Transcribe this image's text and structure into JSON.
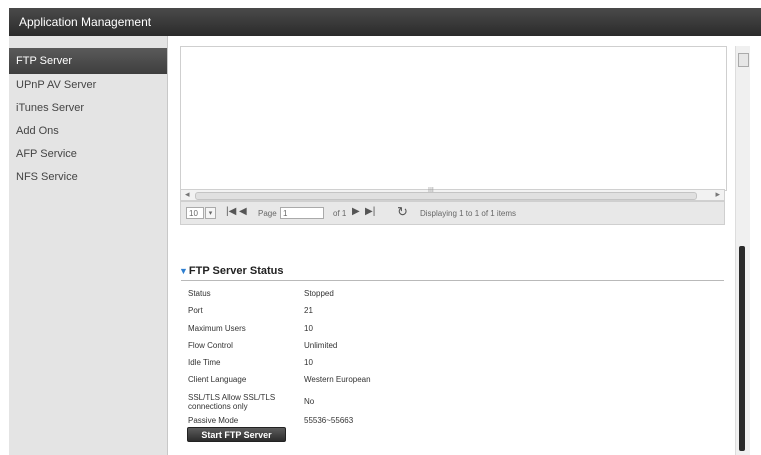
{
  "window": {
    "title": "Application Management"
  },
  "sidebar": {
    "items": [
      {
        "label": "FTP Server"
      },
      {
        "label": "UPnP AV Server"
      },
      {
        "label": "iTunes Server"
      },
      {
        "label": "Add Ons"
      },
      {
        "label": "AFP Service"
      },
      {
        "label": "NFS Service"
      }
    ]
  },
  "grid": {
    "hscroll_grip": "III",
    "pager": {
      "page_size": "10",
      "page_label": "Page",
      "page_value": "1",
      "of_label": "of 1",
      "displaying": "Displaying 1 to 1 of 1 items"
    }
  },
  "status": {
    "title": "FTP Server Status",
    "rows": [
      {
        "label": "Status",
        "value": "Stopped"
      },
      {
        "label": "Port",
        "value": "21"
      },
      {
        "label": "Maximum Users",
        "value": "10"
      },
      {
        "label": "Flow Control",
        "value": "Unlimited"
      },
      {
        "label": "Idle Time",
        "value": "10"
      },
      {
        "label": "Client Language",
        "value": "Western European"
      },
      {
        "label": "SSL/TLS Allow SSL/TLS connections only",
        "value": "No"
      },
      {
        "label": "Passive Mode",
        "value": "55536~55663"
      }
    ],
    "start_button": "Start FTP Server"
  }
}
